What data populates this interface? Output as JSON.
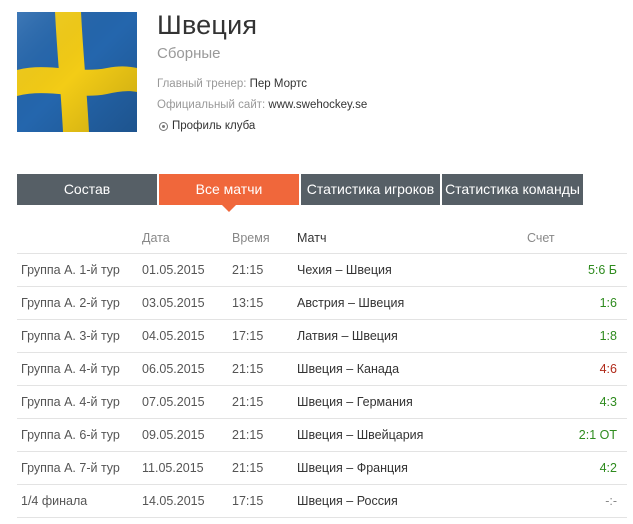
{
  "colors": {
    "tab_active": "#f0673b",
    "tab_inactive": "#565f66",
    "win": "#2e8b1e",
    "loss": "#b02a1a"
  },
  "team": {
    "name": "Швеция",
    "subtitle": "Сборные",
    "coach_label": "Главный тренер:",
    "coach_value": "Пер Мортс",
    "site_label": "Официальный сайт:",
    "site_value": "www.swehockey.se",
    "profile_link": "Профиль клуба"
  },
  "tabs": [
    {
      "label": "Состав"
    },
    {
      "label": "Все матчи"
    },
    {
      "label": "Статистика игроков"
    },
    {
      "label": "Статистика команды"
    }
  ],
  "table": {
    "headers": {
      "round": "",
      "date": "Дата",
      "time": "Время",
      "match": "Матч",
      "score": "Счет"
    },
    "rows": [
      {
        "round": "Группа А. 1-й тур",
        "date": "01.05.2015",
        "time": "21:15",
        "match": "Чехия – Швеция",
        "score": "5:6 Б",
        "result": "win"
      },
      {
        "round": "Группа А. 2-й тур",
        "date": "03.05.2015",
        "time": "13:15",
        "match": "Австрия – Швеция",
        "score": "1:6",
        "result": "win"
      },
      {
        "round": "Группа А. 3-й тур",
        "date": "04.05.2015",
        "time": "17:15",
        "match": "Латвия – Швеция",
        "score": "1:8",
        "result": "win"
      },
      {
        "round": "Группа А. 4-й тур",
        "date": "06.05.2015",
        "time": "21:15",
        "match": "Швеция – Канада",
        "score": "4:6",
        "result": "loss"
      },
      {
        "round": "Группа А. 4-й тур",
        "date": "07.05.2015",
        "time": "21:15",
        "match": "Швеция – Германия",
        "score": "4:3",
        "result": "win"
      },
      {
        "round": "Группа А. 6-й тур",
        "date": "09.05.2015",
        "time": "21:15",
        "match": "Швеция – Швейцария",
        "score": "2:1 ОТ",
        "result": "win"
      },
      {
        "round": "Группа А. 7-й тур",
        "date": "11.05.2015",
        "time": "21:15",
        "match": "Швеция – Франция",
        "score": "4:2",
        "result": "win"
      },
      {
        "round": "1/4 финала",
        "date": "14.05.2015",
        "time": "17:15",
        "match": "Швеция – Россия",
        "score": "-:-",
        "result": "none"
      }
    ]
  }
}
